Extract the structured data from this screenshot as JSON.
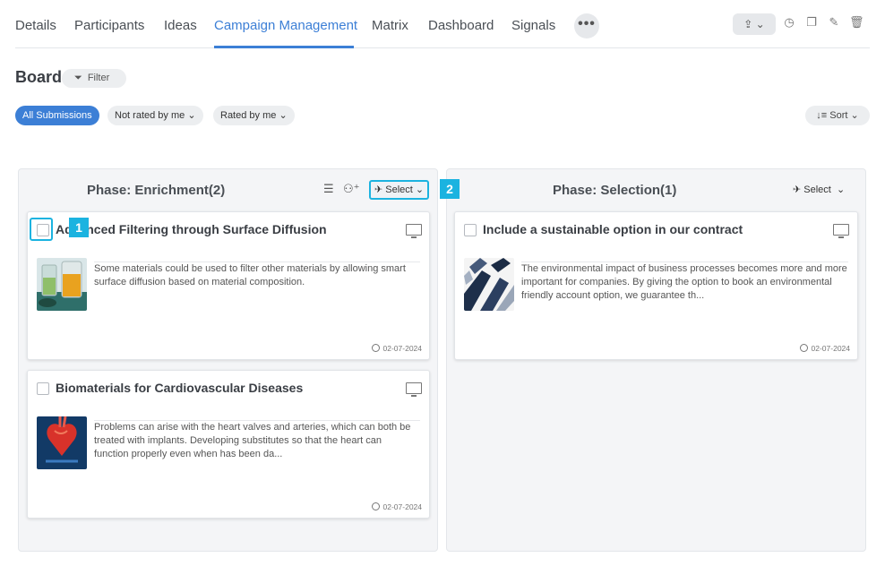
{
  "tabs": [
    {
      "label": "Details",
      "active": false
    },
    {
      "label": "Participants",
      "active": false
    },
    {
      "label": "Ideas",
      "active": false
    },
    {
      "label": "Campaign Management",
      "active": true
    },
    {
      "label": "Matrix",
      "active": false
    },
    {
      "label": "Dashboard",
      "active": false
    },
    {
      "label": "Signals",
      "active": false
    }
  ],
  "toolbar": {
    "more_label": "•••",
    "export_label": "⇪ ⌄",
    "icons": [
      "history-icon",
      "copy-icon",
      "edit-icon",
      "delete-icon"
    ]
  },
  "board": {
    "title": "Board",
    "filter_label": "Filter"
  },
  "filters": {
    "all_label": "All Submissions",
    "not_rated_label": "Not rated by me",
    "rated_label": "Rated by me",
    "sort_label": "Sort"
  },
  "columns": [
    {
      "title": "Phase: Enrichment(2)",
      "select_label": "Select",
      "cards": [
        {
          "title": "Advanced Filtering through Surface Diffusion",
          "text": "Some materials could be used to filter other materials by allowing smart surface diffusion based on material composition.",
          "date": "02-07-2024"
        },
        {
          "title": "Biomaterials for Cardiovascular Diseases",
          "text": "Problems can arise with the heart valves and arteries, which can both be treated with implants. Developing substitutes so that the heart can function properly even when has been da...",
          "date": "02-07-2024"
        }
      ]
    },
    {
      "title": "Phase: Selection(1)",
      "select_label": "Select",
      "cards": [
        {
          "title": "Include a sustainable option in our contract",
          "text": "The environmental impact of business processes becomes more and more important for companies. By giving the option to book an environmental friendly account option, we guarantee th...",
          "date": "02-07-2024"
        }
      ]
    }
  ],
  "markers": [
    "1",
    "2"
  ],
  "colors": {
    "accent": "#3c7fd6",
    "callout": "#1bb3e0"
  }
}
